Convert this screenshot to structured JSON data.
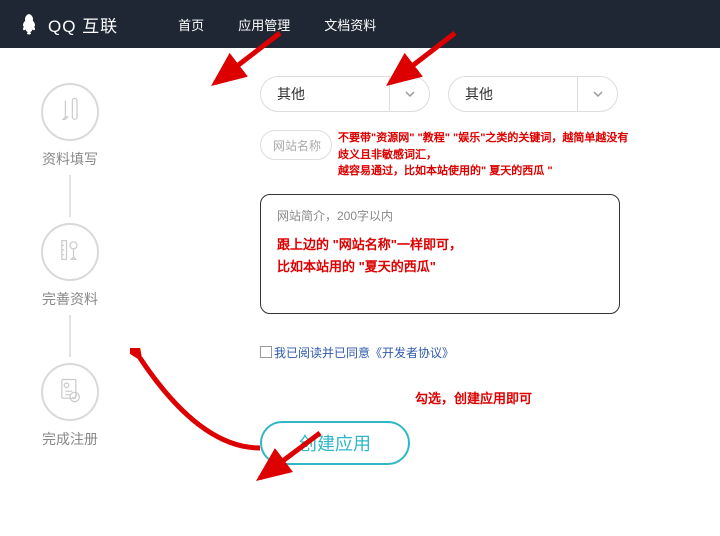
{
  "header": {
    "logo_text": "QQ 互联",
    "nav": {
      "home": "首页",
      "app": "应用管理",
      "doc": "文档资料"
    }
  },
  "steps": {
    "s1": "资料填写",
    "s2": "完善资料",
    "s3": "完成注册"
  },
  "form": {
    "select1": "其他",
    "select2": "其他",
    "site_name_placeholder": "网站名称",
    "desc_placeholder": "网站简介，200字以内",
    "agree_text": "我已阅读并已同意",
    "agree_link": "《开发者协议》",
    "submit_label": "创建应用"
  },
  "annotations": {
    "name_tip_l1": "不要带\"资源网\" \"教程\" \"娱乐\"之类的关键词，越简单越没有歧义且非敏感词汇，",
    "name_tip_l2": "越容易通过，比如本站使用的\" 夏天的西瓜 \"",
    "desc_tip_l1": "跟上边的 \"网站名称\"一样即可，",
    "desc_tip_l2": "比如本站用的 \"夏天的西瓜\"",
    "check_tip": "勾选，创建应用即可"
  },
  "icons": {
    "penguin": "penguin-icon",
    "chevron": "chevron-down-icon",
    "pencil": "pencil-icon",
    "ruler": "ruler-icon",
    "doc": "doc-check-icon"
  }
}
